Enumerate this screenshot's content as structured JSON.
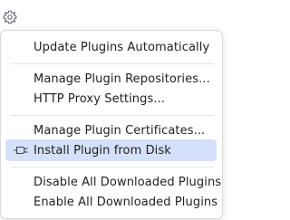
{
  "menu": {
    "items": [
      {
        "label": "Update Plugins Automatically"
      },
      {
        "label": "Manage Plugin Repositories..."
      },
      {
        "label": "HTTP Proxy Settings..."
      },
      {
        "label": "Manage Plugin Certificates..."
      },
      {
        "label": "Install Plugin from Disk",
        "selected": true,
        "icon": "plug-icon"
      },
      {
        "label": "Disable All Downloaded Plugins"
      },
      {
        "label": "Enable All Downloaded Plugins"
      }
    ]
  },
  "toolbar": {
    "settings_icon": "gear-icon"
  },
  "colors": {
    "selected_bg": "#d5e1fa",
    "text": "#1f1f1f",
    "separator": "#e4e5e8"
  }
}
